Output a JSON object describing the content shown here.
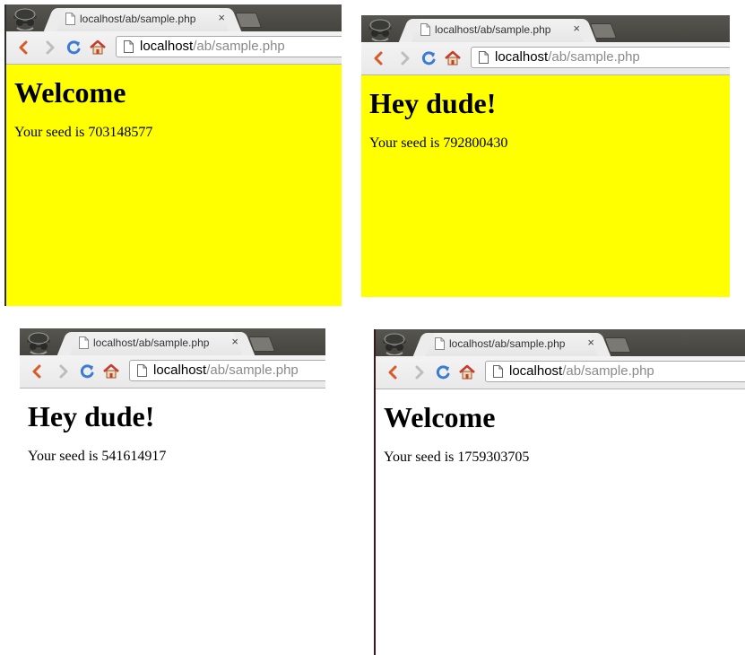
{
  "windows": [
    {
      "tab_title": "localhost/ab/sample.php",
      "tab_close": "×",
      "url_host": "localhost",
      "url_path": "/ab/sample.php",
      "heading": "Welcome",
      "seed_text": "Your seed is 703148577",
      "page_bg": "#ffff00"
    },
    {
      "tab_title": "localhost/ab/sample.php",
      "tab_close": "×",
      "url_host": "localhost",
      "url_path": "/ab/sample.php",
      "heading": "Hey dude!",
      "seed_text": "Your seed is 792800430",
      "page_bg": "#ffff00"
    },
    {
      "tab_title": "localhost/ab/sample.php",
      "tab_close": "×",
      "url_host": "localhost",
      "url_path": "/ab/sample.php",
      "heading": "Hey dude!",
      "seed_text": "Your seed is 541614917",
      "page_bg": "#ffffff"
    },
    {
      "tab_title": "localhost/ab/sample.php",
      "tab_close": "×",
      "url_host": "localhost",
      "url_path": "/ab/sample.php",
      "heading": "Welcome",
      "seed_text": "Your seed is 1759303705",
      "page_bg": "#ffffff"
    }
  ],
  "icons": {
    "incognito": "incognito-icon",
    "page": "page-icon",
    "back": "back-arrow-icon",
    "forward": "forward-arrow-icon",
    "reload": "reload-icon",
    "home": "home-icon"
  }
}
